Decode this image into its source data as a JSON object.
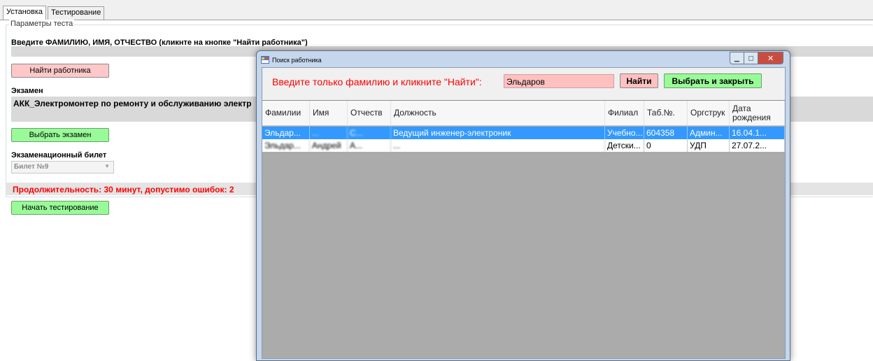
{
  "tabs": [
    {
      "label": "Установка"
    },
    {
      "label": "Тестирование"
    }
  ],
  "group_title": "Параметры теста",
  "fio_label": "Введите ФАМИЛИЮ, ИМЯ, ОТЧЕСТВО (кликнте на кнопке \"Найти работника\")",
  "find_employee_button": "Найти работника",
  "exam_label": "Экзамен",
  "exam_value": "АКК_Электромонтер по ремонту и обслуживанию электр",
  "choose_exam_button": "Выбрать экзамен",
  "ticket_label": "Экзаменационный билет",
  "ticket_value": "Билет №9",
  "duration_text": "Продолжительность: 30 минут, допустимо ошибок: 2",
  "start_test_button": "Начать тестирование",
  "dialog": {
    "title": "Поиск работника",
    "prompt": "Введите только фамилию и кликните \"Найти\":",
    "search_value": "Эльдаров",
    "find_button": "Найти",
    "select_close_button": "Выбрать и закрыть",
    "columns": [
      "Фамилии",
      "Имя",
      "Отчеств",
      "Должность",
      "Филиал",
      "Таб.№.",
      "Оргструк",
      "Дата рождения"
    ],
    "rows": [
      {
        "surname": "Эльдар...",
        "name": "...",
        "patronymic": "С...",
        "position": "Ведущий инженер-электроник",
        "branch": "Учебно...",
        "tab_no": "604358",
        "org": "Админ...",
        "birth": "16.04.1..."
      },
      {
        "surname": "Эльдар...",
        "name": "Андрей",
        "patronymic": "А...",
        "position": "...",
        "branch": "Детски...",
        "tab_no": "0",
        "org": "УДП",
        "birth": "27.07.2..."
      }
    ]
  }
}
